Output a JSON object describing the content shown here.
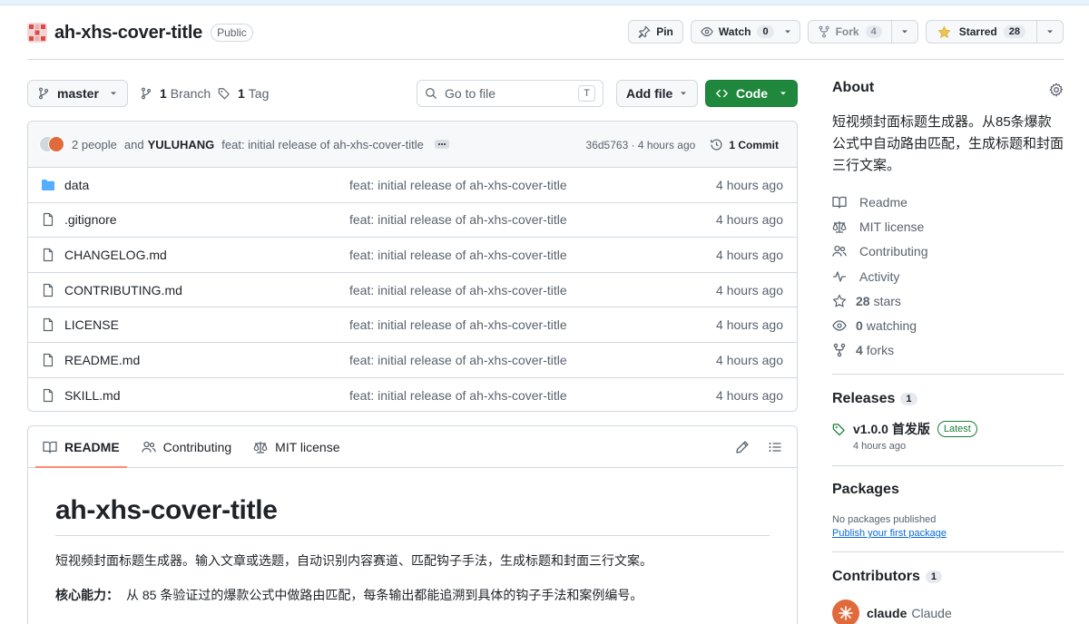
{
  "repo": {
    "name": "ah-xhs-cover-title",
    "visibility": "Public"
  },
  "actions": {
    "pin_label": "Pin",
    "watch_label": "Watch",
    "watch_count": "0",
    "fork_label": "Fork",
    "fork_count": "4",
    "star_label": "Starred",
    "star_count": "28"
  },
  "toolbar": {
    "branch": "master",
    "branch_count": "1",
    "branch_label": "Branch",
    "tag_count": "1",
    "tag_label": "Tag",
    "goto_placeholder": "Go to file",
    "goto_kbd": "T",
    "add_file_label": "Add file",
    "code_label": "Code"
  },
  "commit": {
    "people": "2 people",
    "and_text": "and",
    "author": "YULUHANG",
    "message": "feat: initial release of ah-xhs-cover-title",
    "hash": "36d5763",
    "separator": " · ",
    "age": "4 hours ago",
    "commits_label": "1 Commit"
  },
  "files": [
    {
      "name": "data",
      "type": "folder",
      "message": "feat: initial release of ah-xhs-cover-title",
      "age": "4 hours ago"
    },
    {
      "name": ".gitignore",
      "type": "file",
      "message": "feat: initial release of ah-xhs-cover-title",
      "age": "4 hours ago"
    },
    {
      "name": "CHANGELOG.md",
      "type": "file",
      "message": "feat: initial release of ah-xhs-cover-title",
      "age": "4 hours ago"
    },
    {
      "name": "CONTRIBUTING.md",
      "type": "file",
      "message": "feat: initial release of ah-xhs-cover-title",
      "age": "4 hours ago"
    },
    {
      "name": "LICENSE",
      "type": "file",
      "message": "feat: initial release of ah-xhs-cover-title",
      "age": "4 hours ago"
    },
    {
      "name": "README.md",
      "type": "file",
      "message": "feat: initial release of ah-xhs-cover-title",
      "age": "4 hours ago"
    },
    {
      "name": "SKILL.md",
      "type": "file",
      "message": "feat: initial release of ah-xhs-cover-title",
      "age": "4 hours ago"
    }
  ],
  "readme": {
    "tabs": [
      "README",
      "Contributing",
      "MIT license"
    ],
    "title": "ah-xhs-cover-title",
    "intro": "短视频封面标题生成器。输入文章或选题，自动识别内容赛道、匹配钩子手法，生成标题和封面三行文案。",
    "core_label": "核心能力：",
    "core_text": "从 85 条验证过的爆款公式中做路由匹配，每条输出都能追溯到具体的钩子手法和案例编号。"
  },
  "about": {
    "heading": "About",
    "description": "短视频封面标题生成器。从85条爆款公式中自动路由匹配，生成标题和封面三行文案。",
    "links": [
      {
        "icon": "book-icon",
        "count": "",
        "label": "Readme"
      },
      {
        "icon": "law-icon",
        "count": "",
        "label": "MIT license"
      },
      {
        "icon": "people-icon",
        "count": "",
        "label": "Contributing"
      },
      {
        "icon": "pulse-icon",
        "count": "",
        "label": "Activity"
      },
      {
        "icon": "star-icon",
        "count": "28",
        "label": "stars"
      },
      {
        "icon": "eye-icon",
        "count": "0",
        "label": "watching"
      },
      {
        "icon": "fork-icon",
        "count": "4",
        "label": "forks"
      }
    ]
  },
  "releases": {
    "heading": "Releases",
    "count": "1",
    "latest_name": "v1.0.0 首发版",
    "latest_badge": "Latest",
    "latest_age": "4 hours ago"
  },
  "packages": {
    "heading": "Packages",
    "none_text": "No packages published",
    "publish_link": "Publish your first package"
  },
  "contributors": {
    "heading": "Contributors",
    "count": "1",
    "first_login": "claude",
    "first_name": "Claude"
  },
  "colors": {
    "primary_green": "#1f883d",
    "tab_underline": "#fd8c73",
    "link_blue": "#0969da",
    "folder_blue": "#54aeff"
  }
}
